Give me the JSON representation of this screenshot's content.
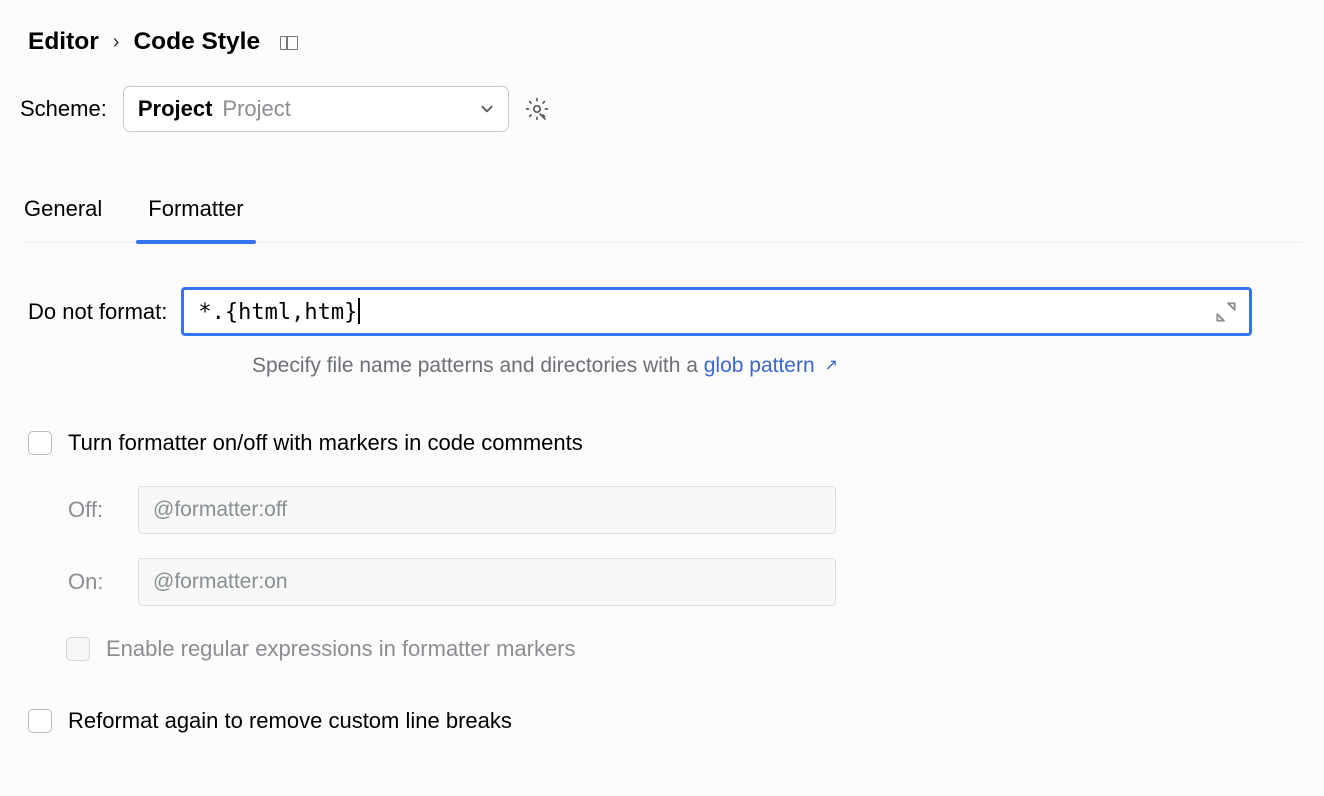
{
  "breadcrumb": {
    "item0": "Editor",
    "item1": "Code Style"
  },
  "scheme": {
    "label": "Scheme:",
    "primary": "Project",
    "secondary": "Project"
  },
  "tabs": {
    "general": "General",
    "formatter": "Formatter"
  },
  "doNotFormat": {
    "label": "Do not format:",
    "value": "*.{html,htm}",
    "hint_prefix": "Specify file name patterns and directories with a ",
    "hint_link": "glob pattern"
  },
  "markers": {
    "label": "Turn formatter on/off with markers in code comments",
    "off_label": "Off:",
    "off_value": "@formatter:off",
    "on_label": "On:",
    "on_value": "@formatter:on",
    "regex_label": "Enable regular expressions in formatter markers"
  },
  "reformat": {
    "label": "Reformat again to remove custom line breaks"
  }
}
